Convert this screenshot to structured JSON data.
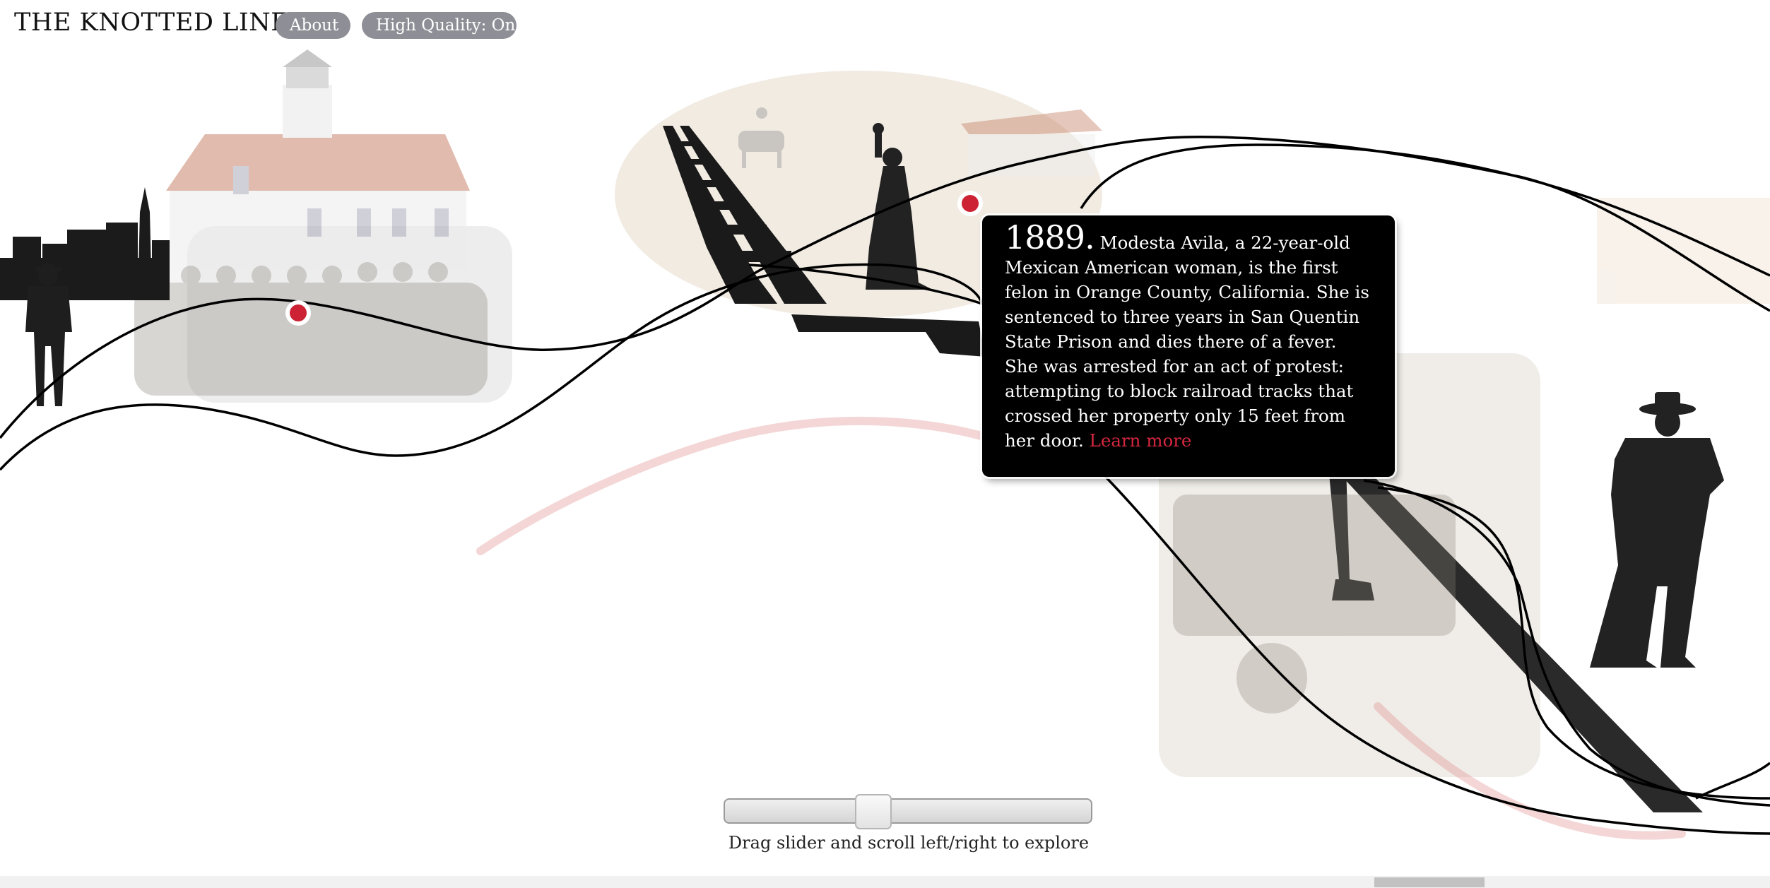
{
  "header": {
    "title": "THE KNOTTED LINE",
    "about_label": "About",
    "quality_label": "High Quality: On"
  },
  "popup": {
    "year": "1889.",
    "text": " Modesta Avila, a 22-year-old Mexican American woman, is the first felon in Orange County, California. She is sentenced to three years in San Quentin State Prison and dies there of a fever. She was arrested for an act of protest: attempting to block railroad tracks that crossed her property only 15 feet from her door. ",
    "link": "Learn more"
  },
  "slider": {
    "hint": "Drag slider and scroll left/right to explore",
    "position_fraction": 0.4
  },
  "colors": {
    "accent_red": "#d6273e",
    "pill_gray": "#8e8f96",
    "popup_bg": "#000000"
  }
}
